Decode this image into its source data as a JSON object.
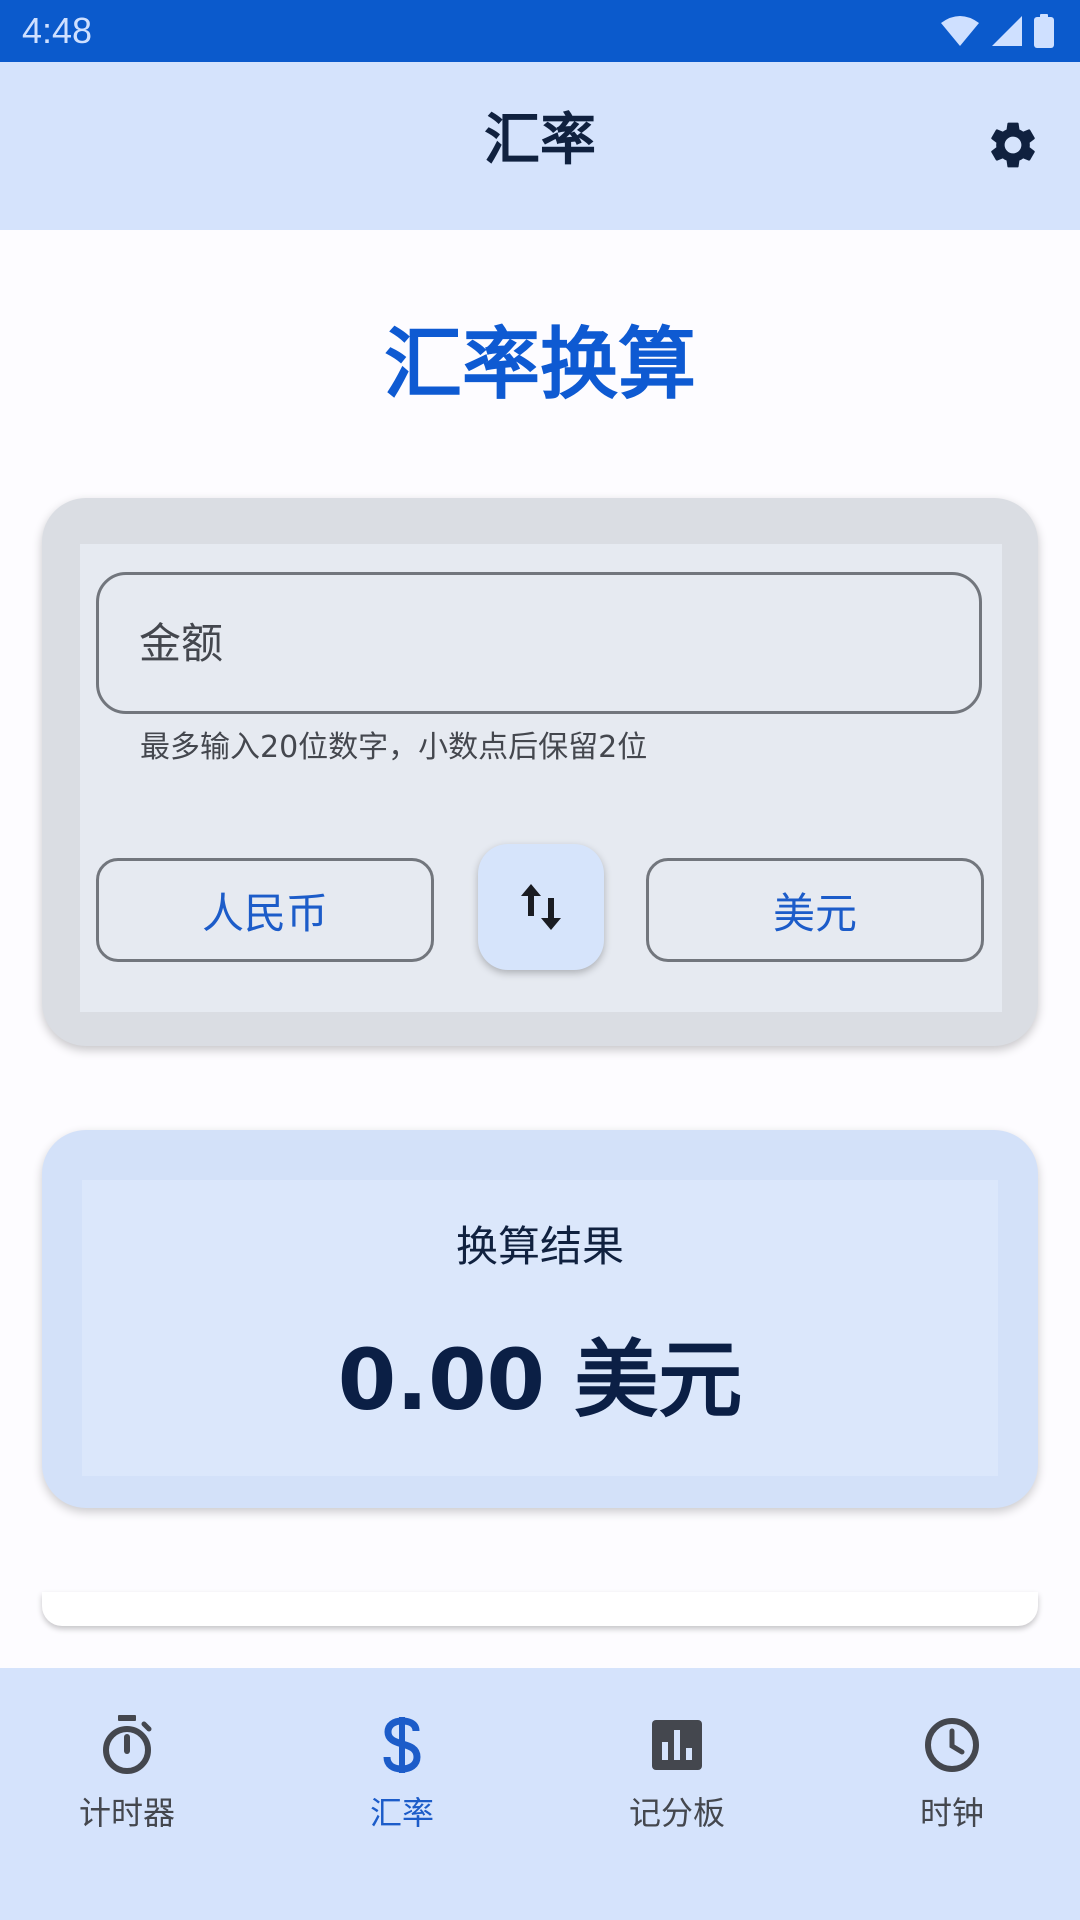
{
  "status_bar": {
    "time": "4:48"
  },
  "app_bar": {
    "title": "汇率",
    "settings_icon": "gear-icon"
  },
  "section": {
    "title": "汇率换算"
  },
  "converter": {
    "amount_placeholder": "金额",
    "amount_value": "",
    "helper_text": "最多输入20位数字，小数点后保留2位",
    "from_currency": "人民币",
    "to_currency": "美元",
    "swap_icon": "swap-vertical-icon"
  },
  "result": {
    "label": "换算结果",
    "value": "0.00 美元"
  },
  "bottom_nav": {
    "items": [
      {
        "label": "计时器",
        "icon": "stopwatch-icon",
        "active": false
      },
      {
        "label": "汇率",
        "icon": "dollar-icon",
        "active": true
      },
      {
        "label": "记分板",
        "icon": "bar-chart-icon",
        "active": false
      },
      {
        "label": "时钟",
        "icon": "clock-icon",
        "active": false
      }
    ]
  },
  "colors": {
    "status_bar": "#0b5acc",
    "app_bar": "#d5e3fc",
    "accent": "#0e5ad2",
    "active_nav": "#1c5cc9"
  }
}
